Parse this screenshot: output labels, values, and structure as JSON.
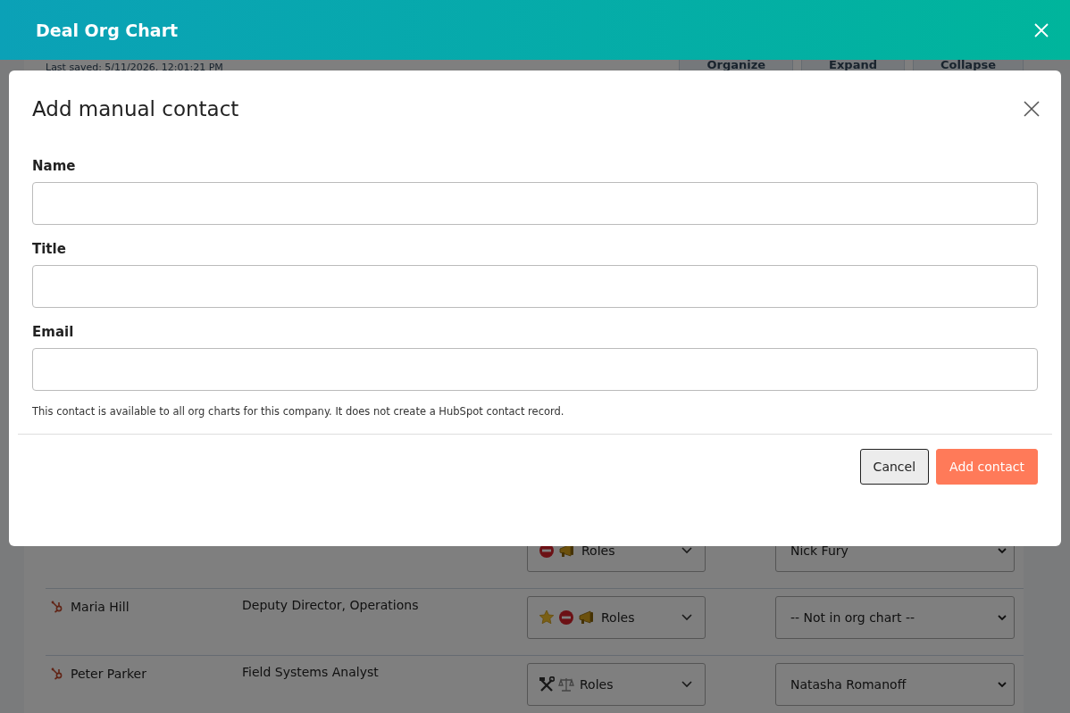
{
  "window": {
    "title": "Deal Org Chart"
  },
  "background": {
    "last_saved": "Last saved: 5/11/2026, 12:01:21 PM",
    "buttons": [
      "Organize",
      "Expand",
      "Collapse"
    ],
    "rows": [
      {
        "name": null,
        "title": null,
        "roles": [
          {
            "kind": "no-entry"
          },
          {
            "kind": "megaphone"
          }
        ],
        "roles_label": "Roles",
        "reports_to": "Nick Fury"
      },
      {
        "name": "Maria Hill",
        "title": "Deputy Director, Operations",
        "roles": [
          {
            "kind": "star"
          },
          {
            "kind": "no-entry"
          },
          {
            "kind": "megaphone"
          }
        ],
        "roles_label": "Roles",
        "reports_to": "-- Not in org chart --"
      },
      {
        "name": "Peter Parker",
        "title": "Field Systems Analyst",
        "roles": [
          {
            "kind": "tools"
          },
          {
            "kind": "scales"
          }
        ],
        "roles_label": "Roles",
        "reports_to": "Natasha Romanoff"
      }
    ]
  },
  "dialog": {
    "title": "Add manual contact",
    "fields": [
      {
        "label": "Name"
      },
      {
        "label": "Title"
      },
      {
        "label": "Email"
      }
    ],
    "note": "This contact is available to all org charts for this company. It does not create a HubSpot contact record.",
    "buttons": [
      {
        "label": "Cancel",
        "kind": "secondary"
      },
      {
        "label": "Add contact",
        "kind": "primary"
      }
    ]
  }
}
